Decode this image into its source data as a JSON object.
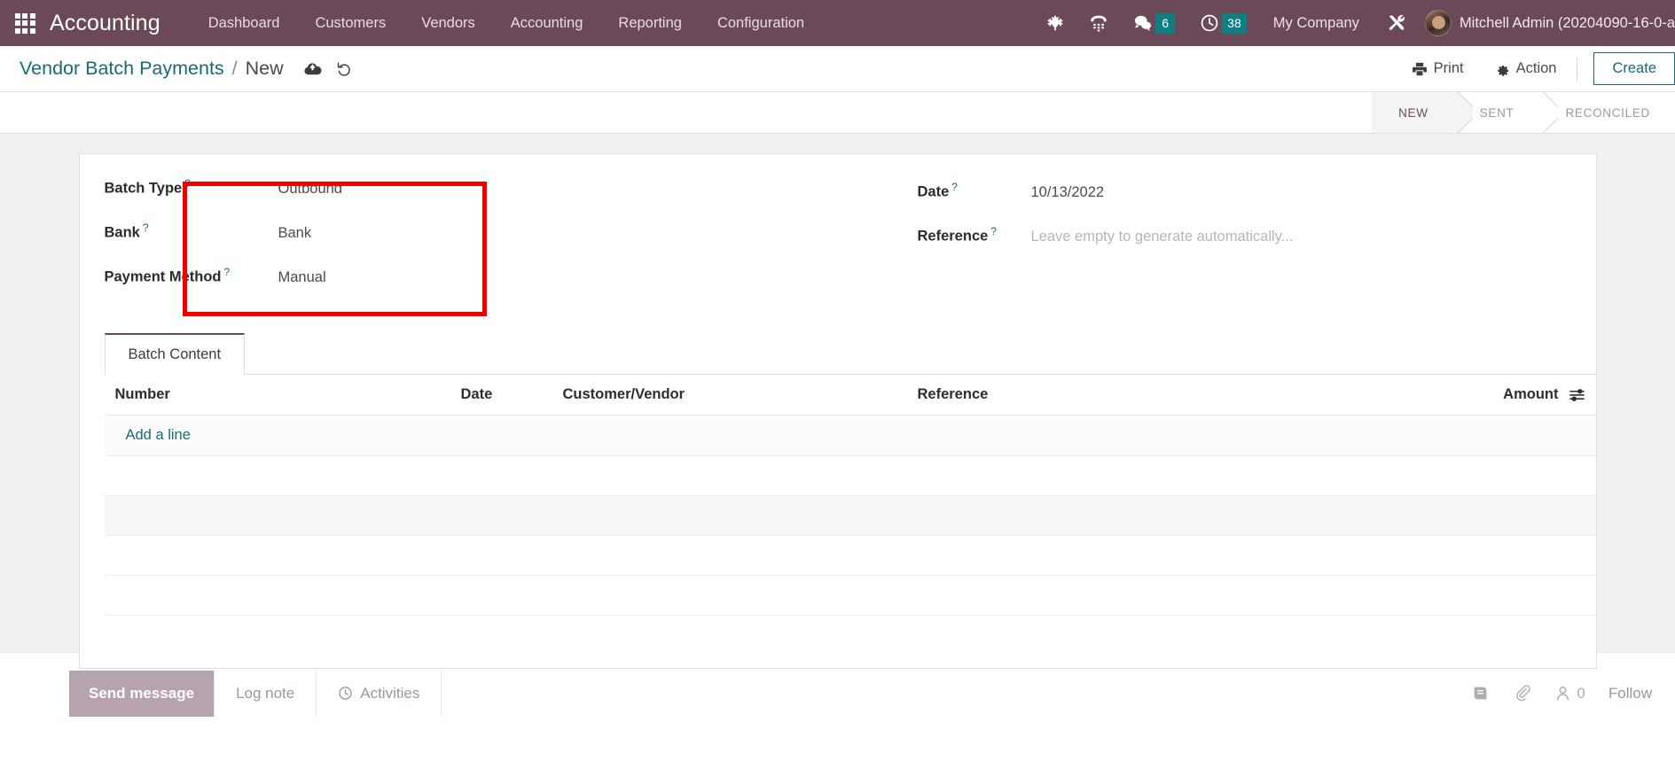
{
  "navbar": {
    "apps_icon": "grid-apps-icon",
    "brand": "Accounting",
    "menus": [
      "Dashboard",
      "Customers",
      "Vendors",
      "Accounting",
      "Reporting",
      "Configuration"
    ],
    "icons": [
      {
        "name": "bug-icon",
        "label": ""
      },
      {
        "name": "phone-dialpad-icon",
        "label": ""
      },
      {
        "name": "messages-icon",
        "badge": "6"
      },
      {
        "name": "activities-clock-icon",
        "badge": "38"
      }
    ],
    "company": "My Company",
    "tools_icon": "tools-icon",
    "user": "Mitchell Admin (20204090-16-0-a",
    "avatar": "user-avatar",
    "badge_color": "#0e7e80",
    "background": "#6b4958"
  },
  "control_panel": {
    "breadcrumb_root": "Vendor Batch Payments",
    "breadcrumb_separator": "/",
    "breadcrumb_current": "New",
    "save_icon": "cloud-upload-save-icon",
    "discard_icon": "undo-discard-icon",
    "print_label": "Print",
    "print_icon": "printer-icon",
    "action_label": "Action",
    "action_icon": "gear-icon",
    "create_label": "Create",
    "accent_color": "#1a6a72"
  },
  "statusbar": {
    "steps": [
      "NEW",
      "SENT",
      "RECONCILED"
    ],
    "active_index": 0
  },
  "form": {
    "left_fields": [
      {
        "label": "Batch Type",
        "help": "?",
        "value": "Outbound"
      },
      {
        "label": "Bank",
        "help": "?",
        "value": "Bank"
      },
      {
        "label": "Payment Method",
        "help": "?",
        "value": "Manual"
      }
    ],
    "right_fields": [
      {
        "label": "Date",
        "help": "?",
        "value": "10/13/2022",
        "is_placeholder": false
      },
      {
        "label": "Reference",
        "help": "?",
        "value": "Leave empty to generate automatically...",
        "is_placeholder": true
      }
    ],
    "annotation_color": "#f20000"
  },
  "notebook": {
    "tabs": [
      {
        "label": "Batch Content",
        "active": true
      }
    ],
    "table": {
      "headers": [
        "Number",
        "Date",
        "Customer/Vendor",
        "Reference",
        "Amount"
      ],
      "optional_columns_icon": "column-options-icon",
      "rows": [],
      "add_line_label": "Add a line"
    }
  },
  "chatter": {
    "tabs": [
      {
        "label": "Send message",
        "active": true,
        "icon": null
      },
      {
        "label": "Log note",
        "active": false,
        "icon": null
      },
      {
        "label": "Activities",
        "active": false,
        "icon": "clock-icon"
      }
    ],
    "log_icon": "log-book-icon",
    "attachment_icon": "paperclip-icon",
    "followers_icon": "followers-person-icon",
    "followers_count": "0",
    "follow_label": "Follow"
  }
}
